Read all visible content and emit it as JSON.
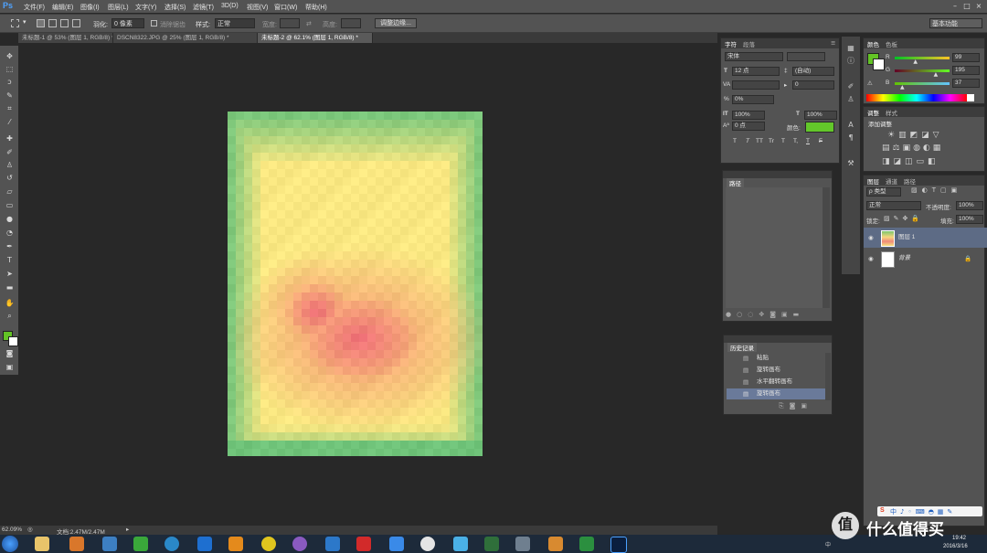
{
  "app": {
    "logo": "Ps",
    "workspace": "基本功能"
  },
  "menu": [
    "文件(F)",
    "编辑(E)",
    "图像(I)",
    "图层(L)",
    "文字(Y)",
    "选择(S)",
    "滤镜(T)",
    "3D(D)",
    "视图(V)",
    "窗口(W)",
    "帮助(H)"
  ],
  "options": {
    "feather_label": "羽化:",
    "feather_value": "0 像素",
    "antialias": "消除锯齿",
    "style_label": "样式:",
    "style_value": "正常",
    "width_label": "宽度:",
    "height_label": "高度:",
    "refine_button": "调整边缘..."
  },
  "tabs": [
    "未标题-1 @ 53% (图层 1, RGB/8) *",
    "DSCN8322.JPG @ 25% (图层 1, RGB/8) *",
    "未标题-2 @ 62.1% (图层 1, RGB/8) *"
  ],
  "char_panel": {
    "tab1": "字符",
    "tab2": "段落",
    "font": "宋体",
    "size": "12 点",
    "leading": "(自动)",
    "tracking": "0",
    "kern_label": "VA",
    "scale_pct": "0%",
    "vscale": "100%",
    "hscale": "100%",
    "baseline": "0 点",
    "color_label": "颜色:",
    "color_hex": "#63c72a",
    "styles": [
      "T",
      "T",
      "TT",
      "Tr",
      "T",
      "T,",
      "T",
      "F"
    ]
  },
  "paths_panel": {
    "title": "路径"
  },
  "history_panel": {
    "title": "历史记录",
    "items": [
      "粘贴",
      "旋转画布",
      "水平翻转画布",
      "旋转画布"
    ]
  },
  "color_panel": {
    "tab1": "颜色",
    "tab2": "色板",
    "r_label": "R",
    "g_label": "G",
    "b_label": "B",
    "r": "99",
    "g": "195",
    "b": "37",
    "r_frac": 0.39,
    "g_frac": 0.76,
    "b_frac": 0.15,
    "fg_color": "#63c325"
  },
  "adjust_panel": {
    "tab1": "调整",
    "tab2": "样式",
    "title": "添加调整"
  },
  "layers_panel": {
    "tab1": "图层",
    "tab2": "通道",
    "tab3": "路径",
    "kind": "ρ 类型",
    "blend": "正常",
    "opacity_label": "不透明度:",
    "opacity": "100%",
    "lock_label": "锁定:",
    "fill_label": "填充:",
    "fill": "100%",
    "layers": [
      {
        "name": "图层 1"
      },
      {
        "name": "背景"
      }
    ]
  },
  "status": {
    "zoom": "62.09%",
    "doc": "文档:2.47M/2.47M"
  },
  "taskbar": {
    "time": "19:42",
    "date": "2016/3/16",
    "watermark": "值 什么值得买",
    "ime": "中"
  }
}
